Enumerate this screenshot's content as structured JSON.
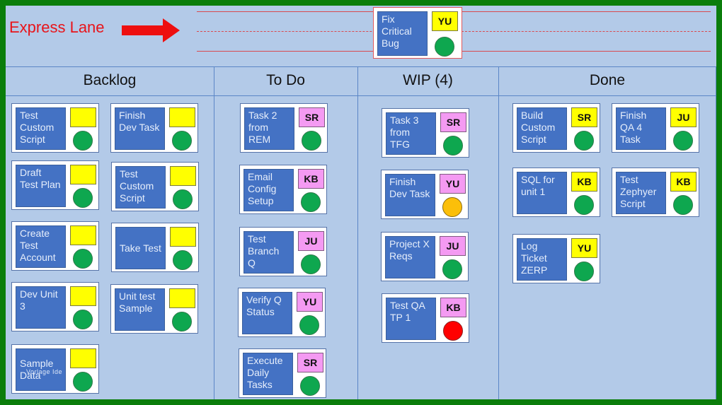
{
  "express_lane": {
    "label": "Express Lane",
    "arrow_icon": "arrow-right-icon",
    "card": {
      "title": "Fix Critical Bug",
      "owner": "YU",
      "owner_color": "#ffff00",
      "status": "green"
    }
  },
  "columns": [
    {
      "title": "Backlog"
    },
    {
      "title": "To Do"
    },
    {
      "title": "WIP (4)"
    },
    {
      "title": "Done"
    }
  ],
  "cards": {
    "backlog": [
      {
        "title": "Test Custom Script",
        "owner": "",
        "status": "green"
      },
      {
        "title": "Finish Dev Task",
        "owner": "",
        "status": "green"
      },
      {
        "title": "Draft Test Plan",
        "owner": "",
        "status": "green"
      },
      {
        "title": "Test Custom Script",
        "owner": "",
        "status": "green"
      },
      {
        "title": "Create Test Account",
        "owner": "",
        "status": "green"
      },
      {
        "title": "Take Test",
        "owner": "",
        "status": "green"
      },
      {
        "title": "Dev Unit 3",
        "owner": "",
        "status": "green"
      },
      {
        "title": "Unit test Sample",
        "owner": "",
        "status": "green"
      },
      {
        "title": "Sample Data",
        "owner": "",
        "status": "green",
        "overlay_text": "Vorlage Ide"
      }
    ],
    "todo": [
      {
        "title": "Task 2 from REM",
        "owner": "SR",
        "status": "green"
      },
      {
        "title": "Email Config Setup",
        "owner": "KB",
        "status": "green"
      },
      {
        "title": "Test Branch Q",
        "owner": "JU",
        "status": "green"
      },
      {
        "title": "Verify Q Status",
        "owner": "YU",
        "status": "green"
      },
      {
        "title": "Execute Daily Tasks",
        "owner": "SR",
        "status": "green"
      }
    ],
    "wip": [
      {
        "title": "Task 3 from TFG",
        "owner": "SR",
        "status": "green"
      },
      {
        "title": "Finish Dev Task",
        "owner": "YU",
        "status": "amber"
      },
      {
        "title": "Project X Reqs",
        "owner": "JU",
        "status": "green"
      },
      {
        "title": "Test QA TP 1",
        "owner": "KB",
        "status": "red"
      }
    ],
    "done": [
      {
        "title": "Build Custom Script",
        "owner": "SR",
        "status": "green"
      },
      {
        "title": "Finish QA 4 Task",
        "owner": "JU",
        "status": "green"
      },
      {
        "title": "SQL for unit 1",
        "owner": "KB",
        "status": "green"
      },
      {
        "title": "Test Zephyer Script",
        "owner": "KB",
        "status": "green"
      },
      {
        "title": "Log Ticket ZERP",
        "owner": "YU",
        "status": "green"
      }
    ]
  },
  "colors": {
    "background_border": "#0b7d0b",
    "board": "#b3cae8",
    "task_blue": "#4472c4",
    "owner_yellow": "#ffff00",
    "owner_pink": "#f49af2",
    "status_green": "#0ea74f",
    "status_amber": "#fbbf0a",
    "status_red": "#ff0000",
    "express_red": "#e8141a"
  }
}
